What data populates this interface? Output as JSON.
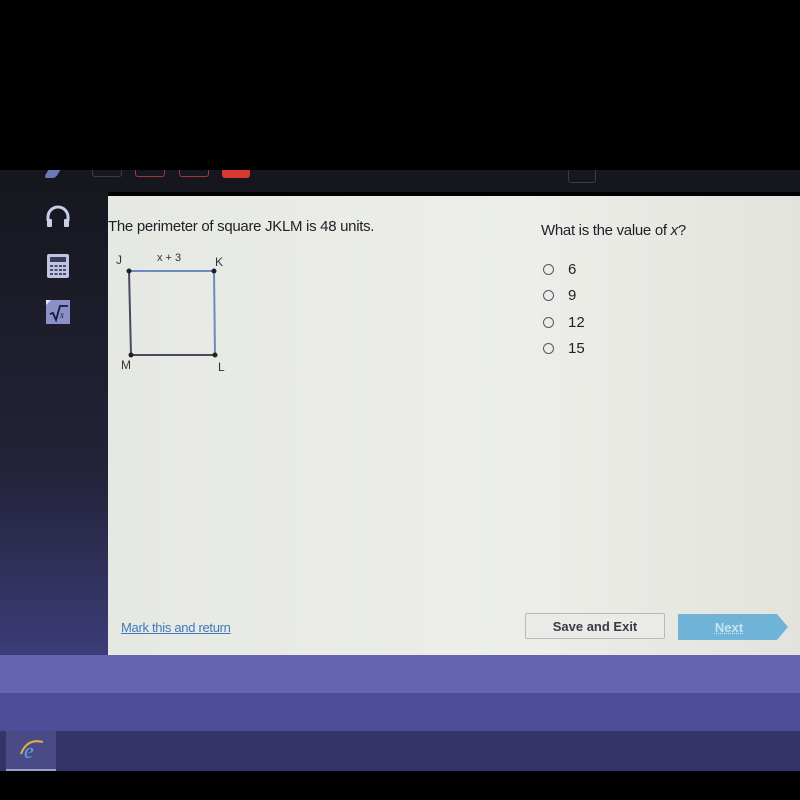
{
  "toolbar": {
    "icons": [
      "pen-icon",
      "tool-box-icon",
      "tool-box-icon",
      "tool-box-icon",
      "tool-red-icon",
      "tool-box-icon"
    ]
  },
  "sidebar": {
    "items": [
      {
        "icon": "headphones-icon",
        "label": "Audio"
      },
      {
        "icon": "calculator-icon",
        "label": "Calculator"
      },
      {
        "icon": "formula-icon",
        "label": "Formula Reference"
      }
    ]
  },
  "question": {
    "stem": "The perimeter of square JKLM is 48 units.",
    "prompt_prefix": "What is the value of ",
    "prompt_var": "x",
    "prompt_suffix": "?",
    "figure": {
      "vertices": {
        "J": "J",
        "K": "K",
        "L": "L",
        "M": "M"
      },
      "side_label": "x + 3"
    },
    "options": [
      {
        "label": "6",
        "selected": false
      },
      {
        "label": "9",
        "selected": false
      },
      {
        "label": "12",
        "selected": false
      },
      {
        "label": "15",
        "selected": false
      }
    ]
  },
  "footer": {
    "mark_link": "Mark this and return",
    "save_label": "Save and Exit",
    "next_label": "Next"
  },
  "taskbar": {
    "browser_icon": "internet-explorer-icon"
  },
  "colors": {
    "link": "#3f7ab8",
    "next_button": "#6fb4d8",
    "accent_red": "#d83a32",
    "figure_line": "#4a6a9a"
  }
}
